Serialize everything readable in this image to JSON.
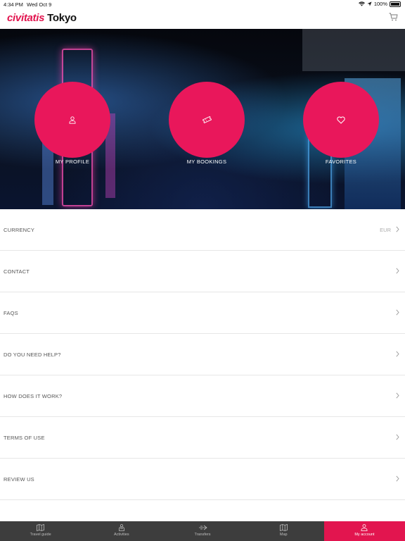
{
  "status_bar": {
    "time": "4:34 PM",
    "date": "Wed Oct 9",
    "battery": "100%"
  },
  "header": {
    "logo": "civitatis",
    "city": "Tokyo",
    "cart_icon": "cart-icon"
  },
  "hero": {
    "bubbles": [
      {
        "label": "MY PROFILE",
        "icon": "user-icon"
      },
      {
        "label": "MY BOOKINGS",
        "icon": "ticket-icon"
      },
      {
        "label": "FAVORITES",
        "icon": "heart-icon"
      }
    ]
  },
  "menu": [
    {
      "label": "CURRENCY",
      "value": "EUR"
    },
    {
      "label": "CONTACT",
      "value": ""
    },
    {
      "label": "FAQS",
      "value": ""
    },
    {
      "label": "DO YOU NEED HELP?",
      "value": ""
    },
    {
      "label": "HOW DOES IT WORK?",
      "value": ""
    },
    {
      "label": "TERMS OF USE",
      "value": ""
    },
    {
      "label": "REVIEW US",
      "value": ""
    }
  ],
  "tabs": [
    {
      "label": "Travel guide",
      "icon": "guide-icon",
      "active": false
    },
    {
      "label": "Activities",
      "icon": "activities-icon",
      "active": false
    },
    {
      "label": "Transfers",
      "icon": "transfers-icon",
      "active": false
    },
    {
      "label": "Map",
      "icon": "map-icon",
      "active": false
    },
    {
      "label": "My account",
      "icon": "user-icon",
      "active": true
    }
  ],
  "colors": {
    "accent": "#e2154f",
    "bubble": "#e9175b",
    "tabbar": "#3d3d3d"
  }
}
